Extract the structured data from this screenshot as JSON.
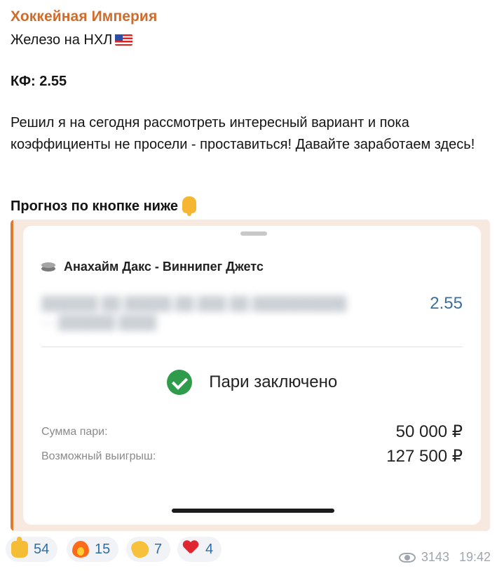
{
  "post": {
    "channel_name": "Хоккейная Империя",
    "line1": "Железо на НХЛ",
    "flag_icon": "us-flag-icon",
    "odds_line": "КФ: 2.55",
    "paragraph": "Решил я на сегодня рассмотреть интересный вариант и пока коэффициенты не просели - проставиться! Давайте заработаем здесь!",
    "cta": "Прогноз по кнопке ниже",
    "cta_icon": "pointing-down-hand-icon"
  },
  "bet_slip": {
    "match": "Анахайм Дакс - Виннипег Джетс",
    "odds": "2.55",
    "status": "Пари заключено",
    "stake_label": "Сумма пари:",
    "stake_value": "50 000 ₽",
    "payout_label": "Возможный выигрыш:",
    "payout_value": "127 500 ₽",
    "accent_color": "#e07a33",
    "success_color": "#2f9c4c"
  },
  "reactions": [
    {
      "icon": "thumbs-up-icon",
      "count": "54"
    },
    {
      "icon": "fire-icon",
      "count": "15"
    },
    {
      "icon": "clapping-hands-icon",
      "count": "7"
    },
    {
      "icon": "heart-icon",
      "count": "4"
    }
  ],
  "footer": {
    "views": "3143",
    "time": "19:42"
  }
}
